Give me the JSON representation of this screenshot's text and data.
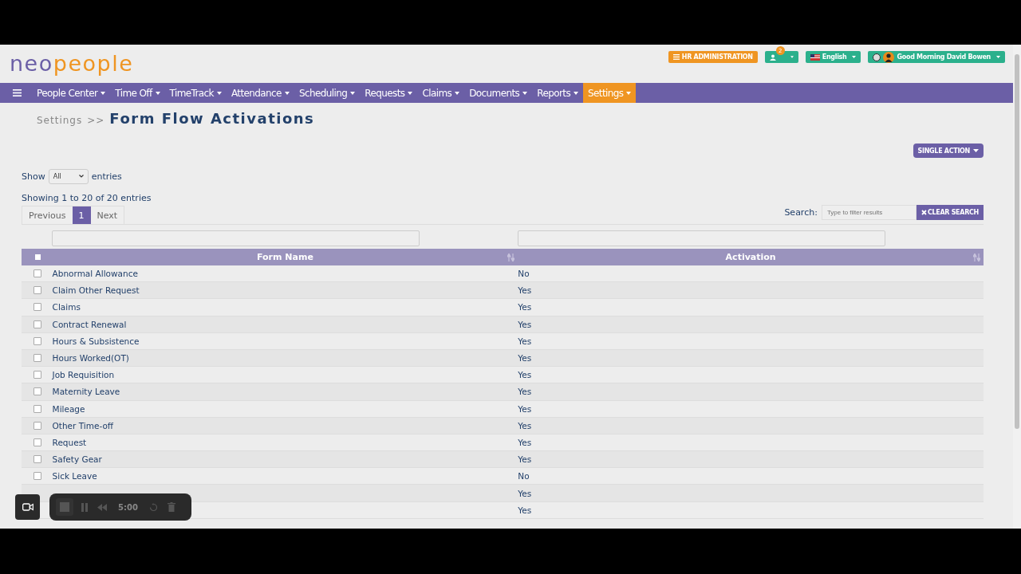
{
  "logo": {
    "part_1": "neo",
    "part_2": "people"
  },
  "top_actions": {
    "admin": "HR ADMINISTRATION",
    "notification_count": "2",
    "language": "English",
    "greeting": "Good Morning David Bowen"
  },
  "nav": [
    {
      "label": "People Center",
      "selected": false
    },
    {
      "label": "Time Off",
      "selected": false
    },
    {
      "label": "TimeTrack",
      "selected": false
    },
    {
      "label": "Attendance",
      "selected": false
    },
    {
      "label": "Scheduling",
      "selected": false
    },
    {
      "label": "Requests",
      "selected": false
    },
    {
      "label": "Claims",
      "selected": false
    },
    {
      "label": "Documents",
      "selected": false
    },
    {
      "label": "Reports",
      "selected": false
    },
    {
      "label": "Settings",
      "selected": true
    }
  ],
  "breadcrumb": {
    "parent": "Settings",
    "separator": ">>",
    "title": "Form Flow Activations"
  },
  "single_action": "SINGLE ACTION",
  "length": {
    "before": "Show",
    "value": "All",
    "after": "entries"
  },
  "info": "Showing 1 to 20 of 20 entries",
  "pagination": {
    "previous": "Previous",
    "page": "1",
    "next": "Next"
  },
  "search": {
    "label": "Search:",
    "placeholder": "Type to filter results",
    "clear": "CLEAR SEARCH"
  },
  "table": {
    "columns": [
      "Form Name",
      "Activation"
    ],
    "select_all_checked": false,
    "rows": [
      {
        "name": "Abnormal Allowance",
        "activation": "No",
        "checked": false
      },
      {
        "name": "Claim Other Request",
        "activation": "Yes",
        "checked": false
      },
      {
        "name": "Claims",
        "activation": "Yes",
        "checked": false
      },
      {
        "name": "Contract Renewal",
        "activation": "Yes",
        "checked": false
      },
      {
        "name": "Hours & Subsistence",
        "activation": "Yes",
        "checked": false
      },
      {
        "name": "Hours Worked(OT)",
        "activation": "Yes",
        "checked": false
      },
      {
        "name": "Job Requisition",
        "activation": "Yes",
        "checked": false
      },
      {
        "name": "Maternity Leave",
        "activation": "Yes",
        "checked": false
      },
      {
        "name": "Mileage",
        "activation": "Yes",
        "checked": false
      },
      {
        "name": "Other Time-off",
        "activation": "Yes",
        "checked": false
      },
      {
        "name": "Request",
        "activation": "Yes",
        "checked": false
      },
      {
        "name": "Safety Gear",
        "activation": "Yes",
        "checked": false
      },
      {
        "name": "Sick Leave",
        "activation": "No",
        "checked": false
      },
      {
        "activation": "Yes"
      },
      {
        "activation": "Yes"
      }
    ]
  },
  "recorder": {
    "time": "5:00"
  }
}
